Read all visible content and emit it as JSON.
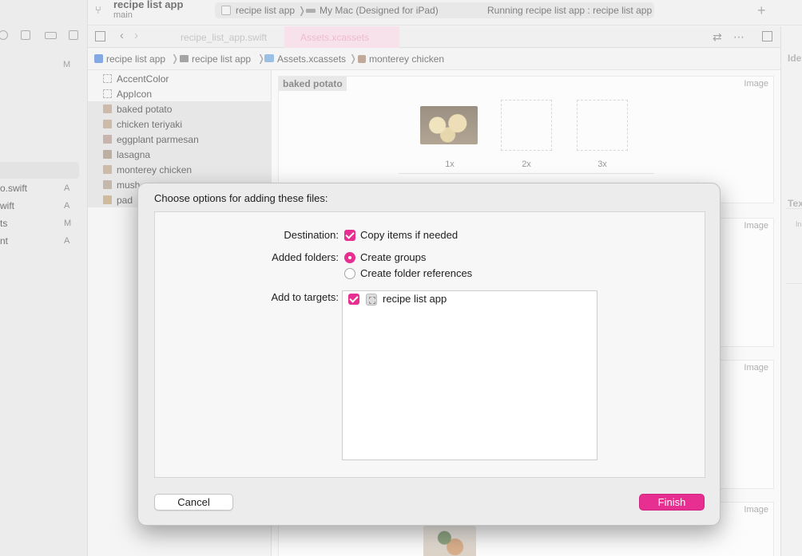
{
  "toolbar": {
    "project_title": "recipe list app",
    "branch": "main",
    "scheme": "recipe list app",
    "destination": "My Mac (Designed for iPad)",
    "status": "Running recipe list app : recipe list app"
  },
  "tabs": [
    {
      "label": "recipe_list_app.swift"
    },
    {
      "label": "Assets.xcassets"
    }
  ],
  "breadcrumb": [
    "recipe list app",
    "recipe list app",
    "Assets.xcassets",
    "monterey chicken"
  ],
  "navigator": {
    "top_status": "M",
    "files": [
      {
        "name": "o.swift",
        "status": "A"
      },
      {
        "name": "wift",
        "status": "A"
      },
      {
        "name": "ts",
        "status": "M"
      },
      {
        "name": "nt",
        "status": "A"
      }
    ]
  },
  "assets": [
    "AccentColor",
    "AppIcon",
    "baked potato",
    "chicken teriyaki",
    "eggplant parmesan",
    "lasagna",
    "monterey chicken",
    "mush",
    "pad"
  ],
  "editor": {
    "set_name": "baked potato",
    "kind_label": "Image",
    "slots": [
      "1x",
      "2x",
      "3x"
    ]
  },
  "inspector": {
    "identity_head": "Ide",
    "text_head": "Tex",
    "text_sub": "In"
  },
  "dialog": {
    "title": "Choose options for adding these files:",
    "destination_label": "Destination:",
    "copy_items": "Copy items if needed",
    "folders_label": "Added folders:",
    "create_groups": "Create groups",
    "create_folder_refs": "Create folder references",
    "targets_label": "Add to targets:",
    "target_name": "recipe list app",
    "cancel_label": "Cancel",
    "finish_label": "Finish"
  },
  "colors": {
    "accent": "#e72f92"
  }
}
